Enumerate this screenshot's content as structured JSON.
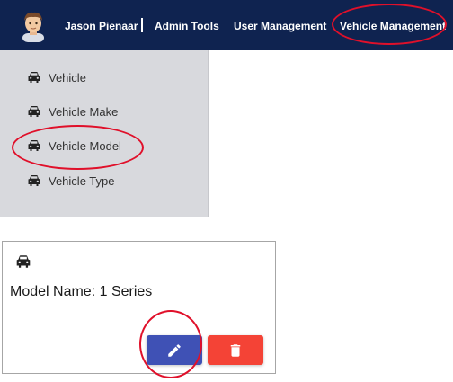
{
  "header": {
    "user_name": "Jason Pienaar",
    "nav": {
      "admin_tools": "Admin Tools",
      "user_management": "User Management",
      "vehicle_management": "Vehicle Management"
    }
  },
  "sidebar": {
    "items": [
      {
        "label": "Vehicle",
        "icon": "car-icon"
      },
      {
        "label": "Vehicle Make",
        "icon": "car-icon"
      },
      {
        "label": "Vehicle Model",
        "icon": "car-icon"
      },
      {
        "label": "Vehicle Type",
        "icon": "car-icon"
      }
    ]
  },
  "card": {
    "icon": "car-icon",
    "title": "Model Name: 1 Series",
    "edit_icon": "pencil-icon",
    "delete_icon": "trash-icon"
  },
  "colors": {
    "topbar": "#0f2350",
    "sidebar": "#d8d9dd",
    "edit_button": "#3f51b5",
    "delete_button": "#f44336",
    "annotation": "#e0102a"
  }
}
